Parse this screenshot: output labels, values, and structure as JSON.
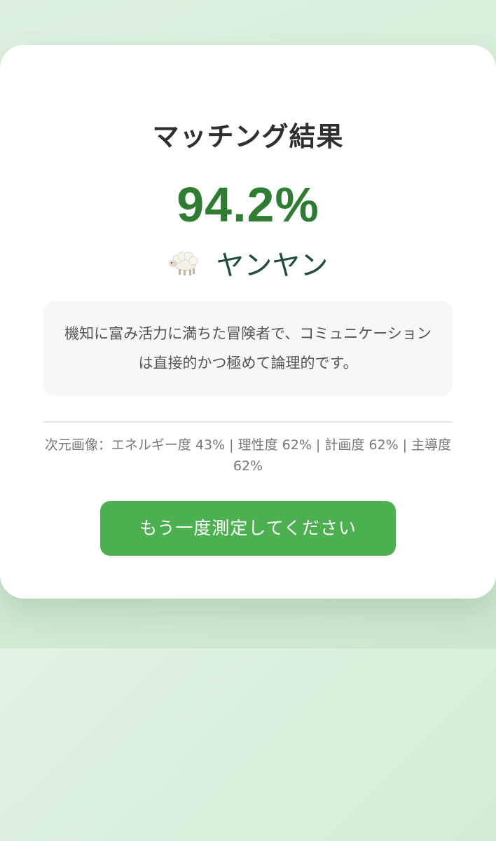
{
  "result": {
    "title": "マッチング結果",
    "score": "94.2%",
    "animal": {
      "icon": "sheep-emoji",
      "name": "ヤンヤン"
    },
    "description": "機知に富み活力に満ちた冒険者で、コミュニケーションは直接的かつ極めて論理的です。",
    "dimensions": "次元画像：エネルギー度 43% | 理性度 62% | 計画度 62% | 主導度 62%",
    "retry_label": "もう一度測定してください"
  },
  "colors": {
    "accent": "#2e7d32",
    "button": "#4caf50",
    "background": "#d3ebd5"
  }
}
